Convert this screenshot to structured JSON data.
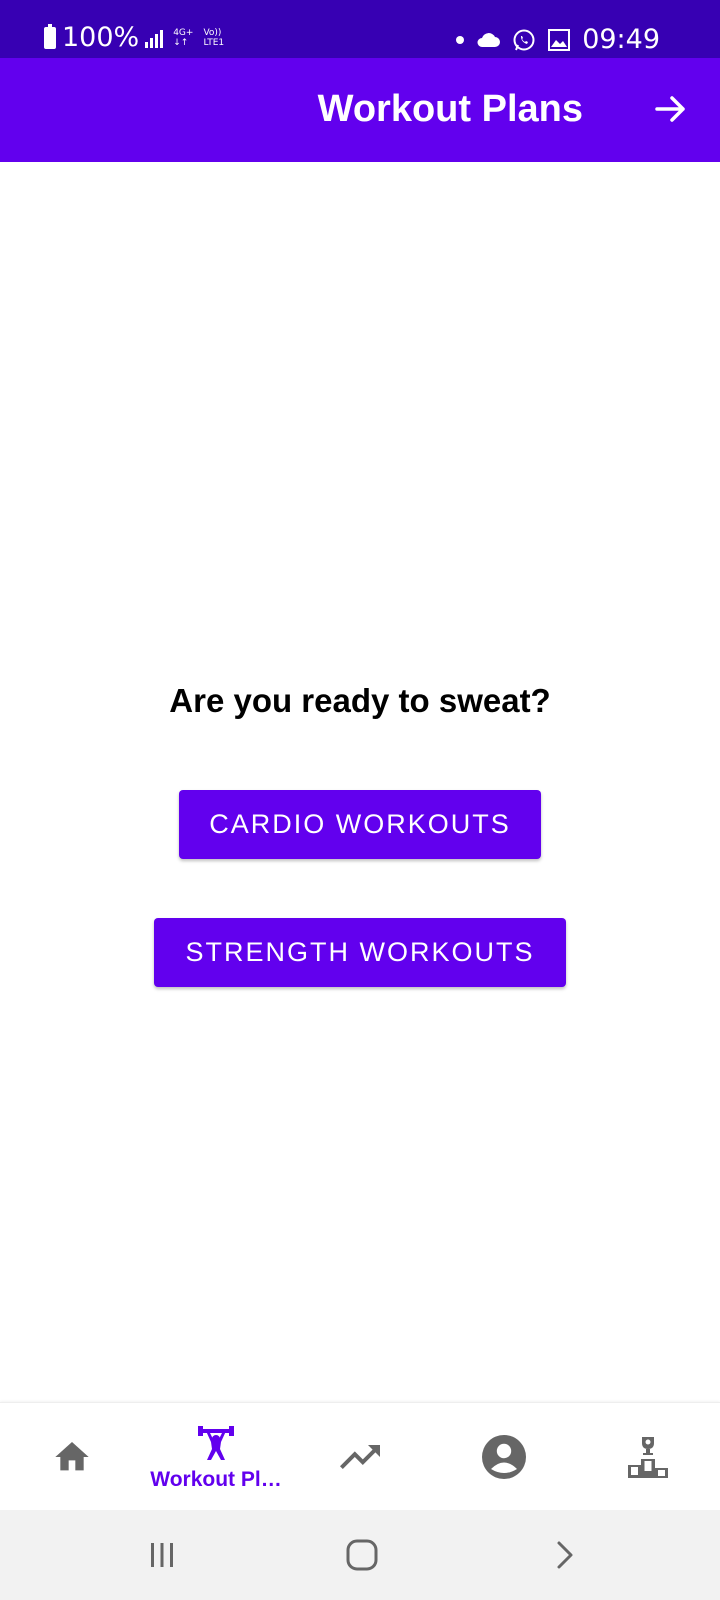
{
  "status_bar": {
    "battery": "100%",
    "network": "4G+",
    "lte": "LTE1",
    "volte": "Vo))",
    "time": "09:49"
  },
  "app_bar": {
    "title": "Workout Plans"
  },
  "main": {
    "headline": "Are you ready to sweat?",
    "cardio_button": "CARDIO WORKOUTS",
    "strength_button": "STRENGTH WORKOUTS"
  },
  "bottom_nav": {
    "items": [
      {
        "icon": "home-icon",
        "label": ""
      },
      {
        "icon": "weightlifting-icon",
        "label": "Workout Pl…"
      },
      {
        "icon": "trending-up-icon",
        "label": ""
      },
      {
        "icon": "account-icon",
        "label": ""
      },
      {
        "icon": "leaderboard-icon",
        "label": ""
      }
    ],
    "active_color": "#6200ee",
    "inactive_color": "#666666"
  },
  "colors": {
    "status_bar": "#3700b3",
    "primary": "#6200ee"
  }
}
